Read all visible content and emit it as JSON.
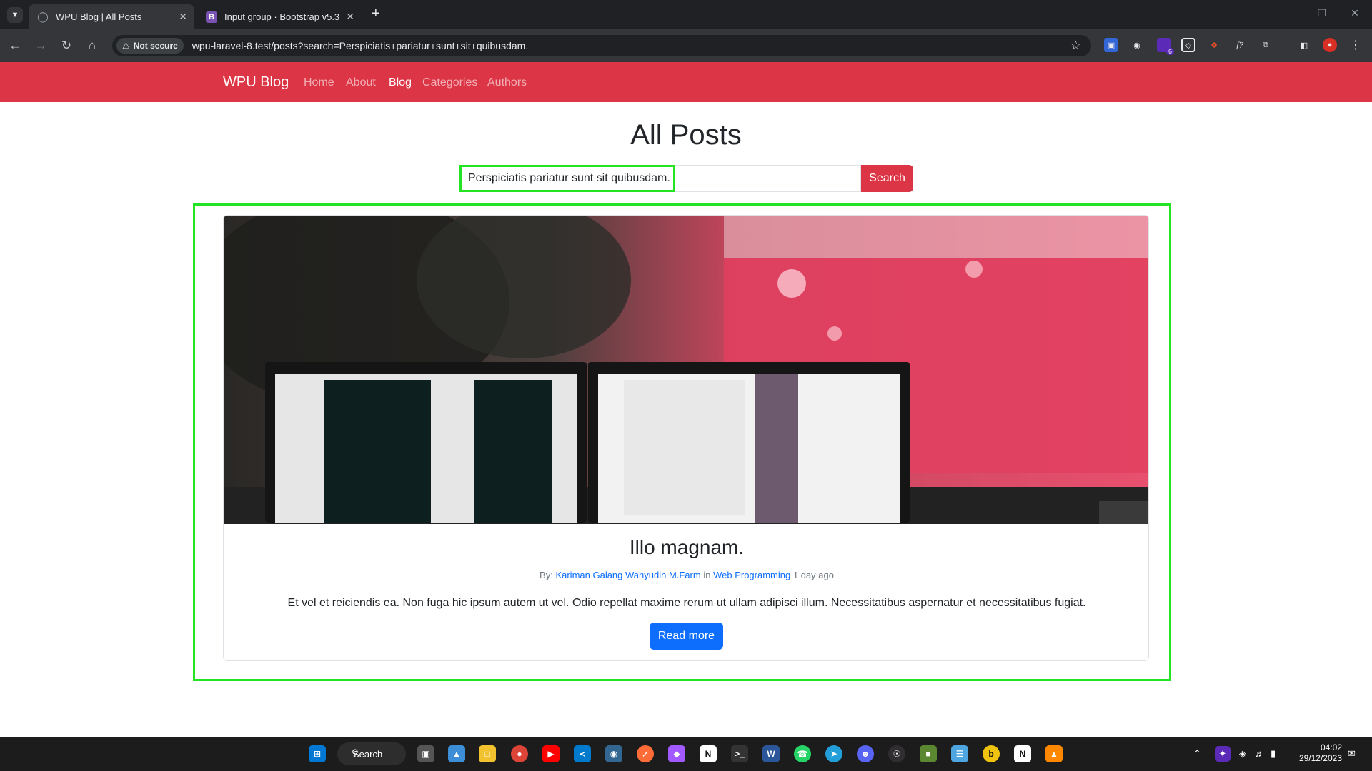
{
  "browser": {
    "tabs": [
      {
        "title": "WPU Blog | All Posts",
        "active": true
      },
      {
        "title": "Input group · Bootstrap v5.3",
        "active": false
      }
    ],
    "tab_favicon_bootstrap": "B",
    "security_chip": "Not secure",
    "url": "wpu-laravel-8.test/posts?search=Perspiciatis+pariatur+sunt+sit+quibusdam.",
    "extension_badge": "6"
  },
  "navbar": {
    "brand": "WPU Blog",
    "links": [
      "Home",
      "About",
      "Blog",
      "Categories",
      "Authors"
    ],
    "active_link": "Blog",
    "color": "#dc3545"
  },
  "page": {
    "title": "All Posts",
    "search": {
      "value": "Perspiciatis pariatur sunt sit quibusdam.",
      "button_label": "Search"
    }
  },
  "post": {
    "title": "Illo magnam.",
    "meta": {
      "by_label": "By:",
      "author": "Kariman Galang Wahyudin M.Farm",
      "in_label": "in",
      "category": "Web Programming",
      "time": "1 day ago"
    },
    "excerpt": "Et vel et reiciendis ea. Non fuga hic ipsum autem ut vel. Odio repellat maxime rerum ut ullam adipisci illum. Necessitatibus aspernatur et necessitatibus fugiat.",
    "read_more": "Read more"
  },
  "taskbar": {
    "search_label": "Search",
    "time": "04:02",
    "date": "29/12/2023"
  },
  "colors": {
    "highlight": "#22e422",
    "primary": "#0d6efd",
    "danger": "#dc3545"
  }
}
